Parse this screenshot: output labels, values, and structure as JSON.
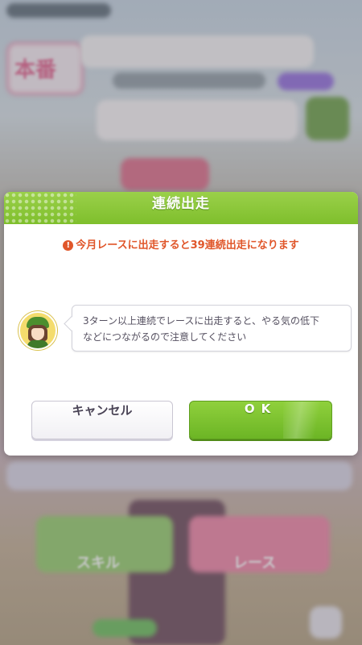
{
  "dialog": {
    "title": "連続出走",
    "warning_icon": "!",
    "warning": "今月レースに出走すると39連続出走になります",
    "advice_lines": [
      "3ターン以上連続でレースに出走すると、やる気の低下",
      "などにつながるので注意してください"
    ],
    "cancel_label": "キャンセル",
    "ok_label": "OK"
  },
  "background": {
    "honban_label": "本番",
    "skill_label": "スキル",
    "race_label": "レース"
  },
  "colors": {
    "header_green": "#7fbf2c",
    "warning_red": "#e0562a",
    "ok_green": "#6cb525"
  }
}
